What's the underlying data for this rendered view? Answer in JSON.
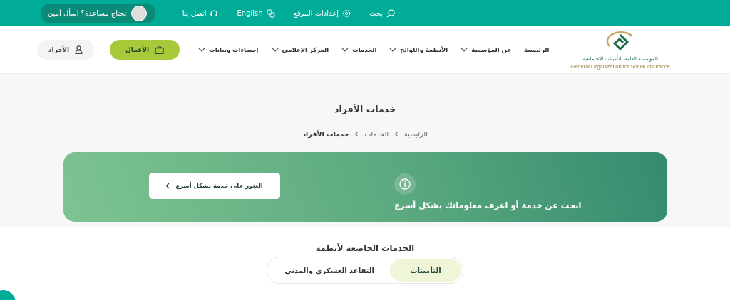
{
  "top_bar": {
    "items": [
      {
        "kind": "search",
        "label": "بحث"
      },
      {
        "kind": "settings",
        "label": "إعدادات الموقع"
      },
      {
        "kind": "language",
        "label": "English"
      },
      {
        "kind": "contact",
        "label": "اتصل بنا"
      }
    ],
    "assistant": {
      "label": "تحتاج مساعدة؟ اسأل أمين"
    }
  },
  "header": {
    "logo": {
      "arabic": "المؤسسة العامة للتأمينات الاجتماعية",
      "english": "General Organization for Social Insurance"
    },
    "menu": [
      {
        "label": "الرئيسية",
        "expandable": false
      },
      {
        "label": "عن المؤسسة",
        "expandable": true
      },
      {
        "label": "الأنظمة واللوائح",
        "expandable": true
      },
      {
        "label": "الخدمات",
        "expandable": true
      },
      {
        "label": "المركز الإعلامي",
        "expandable": true
      },
      {
        "label": "إحصاءات وبيانات",
        "expandable": true
      }
    ],
    "portals": [
      {
        "kind": "business",
        "label": "الأعمال",
        "selected": true
      },
      {
        "kind": "individuals",
        "label": "الأفراد",
        "selected": false
      }
    ]
  },
  "page_title": "خدمات الأفراد",
  "breadcrumb": [
    {
      "label": "الرئيسية",
      "current": false
    },
    {
      "label": "الخدمات",
      "current": false
    },
    {
      "label": "خدمات الأفراد",
      "current": true
    }
  ],
  "banner": {
    "title": "ابحث عن خدمة أو اعرف معلوماتك بشكل أسرع",
    "button": "العثور على خدمة بشكل أسرع"
  },
  "section": {
    "title": "الخدمات الخاضعة لأنظمة",
    "tabs": [
      {
        "label": "التأمينات",
        "selected": true
      },
      {
        "label": "التقاعد العسكري والمدني",
        "selected": false
      }
    ]
  }
}
